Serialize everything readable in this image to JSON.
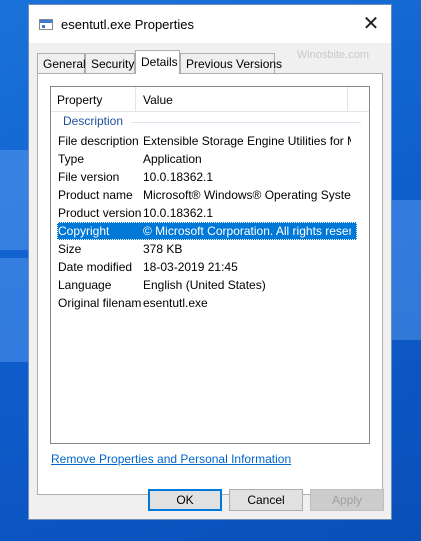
{
  "window": {
    "title": "esentutl.exe Properties",
    "close_glyph": "✕"
  },
  "tabs": [
    {
      "label": "General"
    },
    {
      "label": "Security"
    },
    {
      "label": "Details",
      "active": true
    },
    {
      "label": "Previous Versions"
    }
  ],
  "watermark": "Winosbite.com",
  "details": {
    "columns": {
      "property": "Property",
      "value": "Value"
    },
    "group": "Description",
    "rows": [
      {
        "key": "File description",
        "value": "Extensible Storage Engine Utilities for Mi..."
      },
      {
        "key": "Type",
        "value": "Application"
      },
      {
        "key": "File version",
        "value": "10.0.18362.1"
      },
      {
        "key": "Product name",
        "value": "Microsoft® Windows® Operating System"
      },
      {
        "key": "Product version",
        "value": "10.0.18362.1"
      },
      {
        "key": "Copyright",
        "value": "© Microsoft Corporation. All rights reserv...",
        "selected": true
      },
      {
        "key": "Size",
        "value": "378 KB"
      },
      {
        "key": "Date modified",
        "value": "18-03-2019 21:45"
      },
      {
        "key": "Language",
        "value": "English (United States)"
      },
      {
        "key": "Original filename",
        "value": "esentutl.exe"
      }
    ]
  },
  "remove_link": "Remove Properties and Personal Information",
  "buttons": {
    "ok": "OK",
    "cancel": "Cancel",
    "apply": "Apply"
  },
  "colors": {
    "selection": "#0078d7",
    "link": "#0066cc",
    "desktop": "#1a73d8"
  }
}
